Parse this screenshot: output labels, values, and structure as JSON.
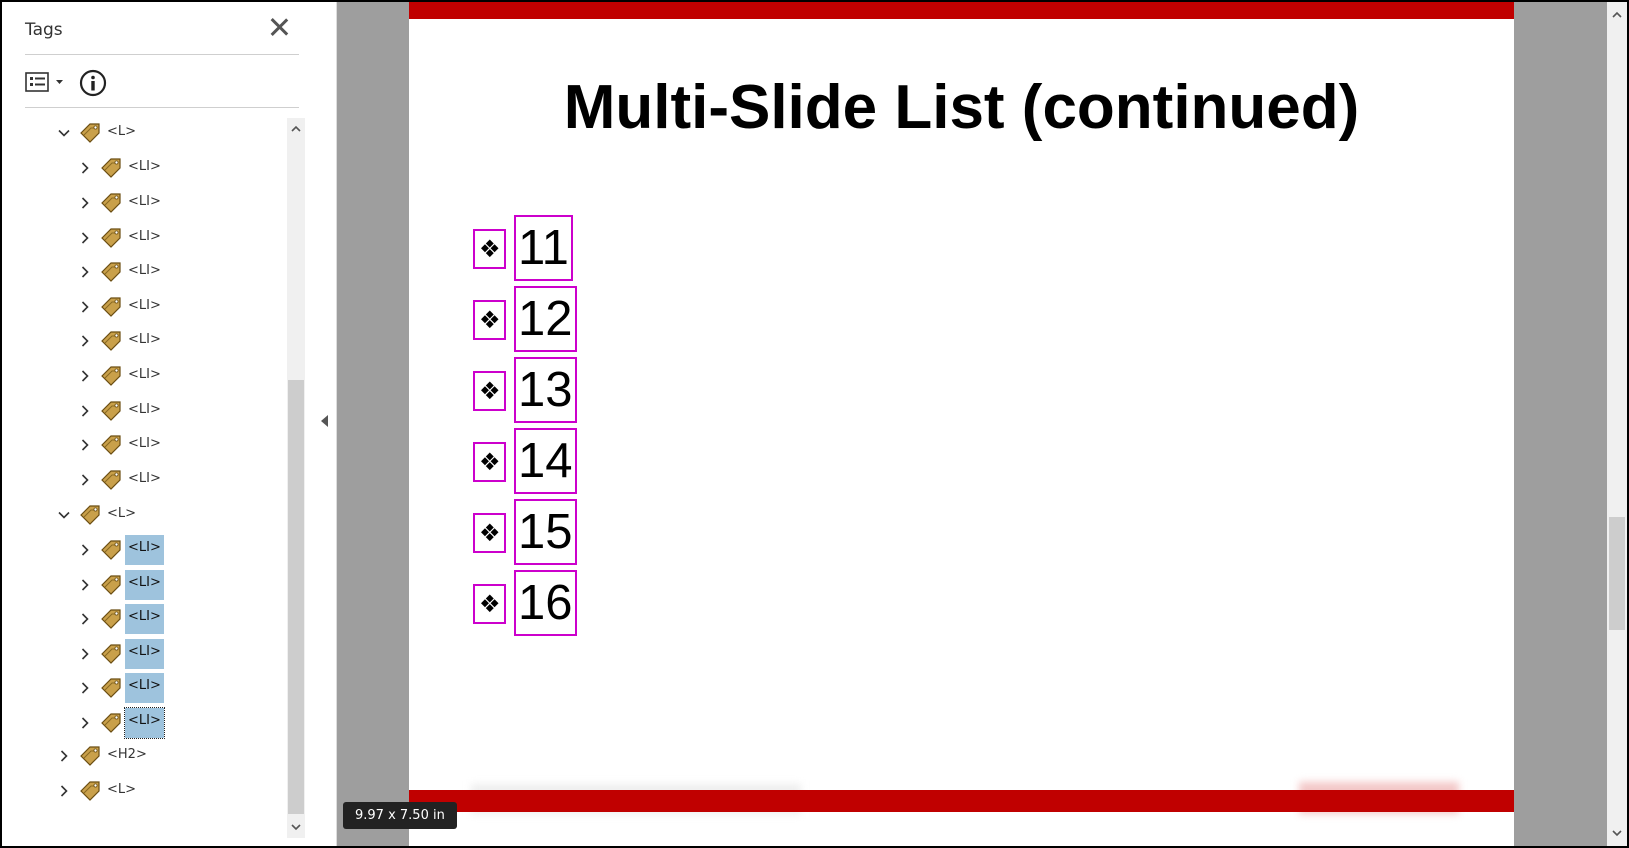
{
  "panel": {
    "title": "Tags",
    "toolbar": {
      "options_icon": "options-menu-icon",
      "info_icon": "info-icon"
    }
  },
  "tree": [
    {
      "label": "<L>",
      "depth": 1,
      "expanded": true,
      "selected": false
    },
    {
      "label": "<LI>",
      "depth": 2,
      "expanded": false,
      "selected": false
    },
    {
      "label": "<LI>",
      "depth": 2,
      "expanded": false,
      "selected": false
    },
    {
      "label": "<LI>",
      "depth": 2,
      "expanded": false,
      "selected": false
    },
    {
      "label": "<LI>",
      "depth": 2,
      "expanded": false,
      "selected": false
    },
    {
      "label": "<LI>",
      "depth": 2,
      "expanded": false,
      "selected": false
    },
    {
      "label": "<LI>",
      "depth": 2,
      "expanded": false,
      "selected": false
    },
    {
      "label": "<LI>",
      "depth": 2,
      "expanded": false,
      "selected": false
    },
    {
      "label": "<LI>",
      "depth": 2,
      "expanded": false,
      "selected": false
    },
    {
      "label": "<LI>",
      "depth": 2,
      "expanded": false,
      "selected": false
    },
    {
      "label": "<LI>",
      "depth": 2,
      "expanded": false,
      "selected": false
    },
    {
      "label": "<L>",
      "depth": 1,
      "expanded": true,
      "selected": false
    },
    {
      "label": "<LI>",
      "depth": 2,
      "expanded": false,
      "selected": true
    },
    {
      "label": "<LI>",
      "depth": 2,
      "expanded": false,
      "selected": true
    },
    {
      "label": "<LI>",
      "depth": 2,
      "expanded": false,
      "selected": true
    },
    {
      "label": "<LI>",
      "depth": 2,
      "expanded": false,
      "selected": true
    },
    {
      "label": "<LI>",
      "depth": 2,
      "expanded": false,
      "selected": true
    },
    {
      "label": "<LI>",
      "depth": 2,
      "expanded": false,
      "selected": true,
      "focused": true
    },
    {
      "label": "<H2>",
      "depth": 1,
      "expanded": false,
      "selected": false
    },
    {
      "label": "<L>",
      "depth": 1,
      "expanded": false,
      "selected": false
    }
  ],
  "slide": {
    "title": "Multi-Slide List (continued)",
    "bullet_symbol": "❖",
    "items": [
      "11",
      "12",
      "13",
      "14",
      "15",
      "16"
    ]
  },
  "page_size_label": "9.97 x 7.50 in",
  "colors": {
    "accent_red": "#c00000",
    "tag_box": "#cc00cc",
    "selection": "#9ec3dd",
    "doc_background": "#9e9e9e"
  }
}
